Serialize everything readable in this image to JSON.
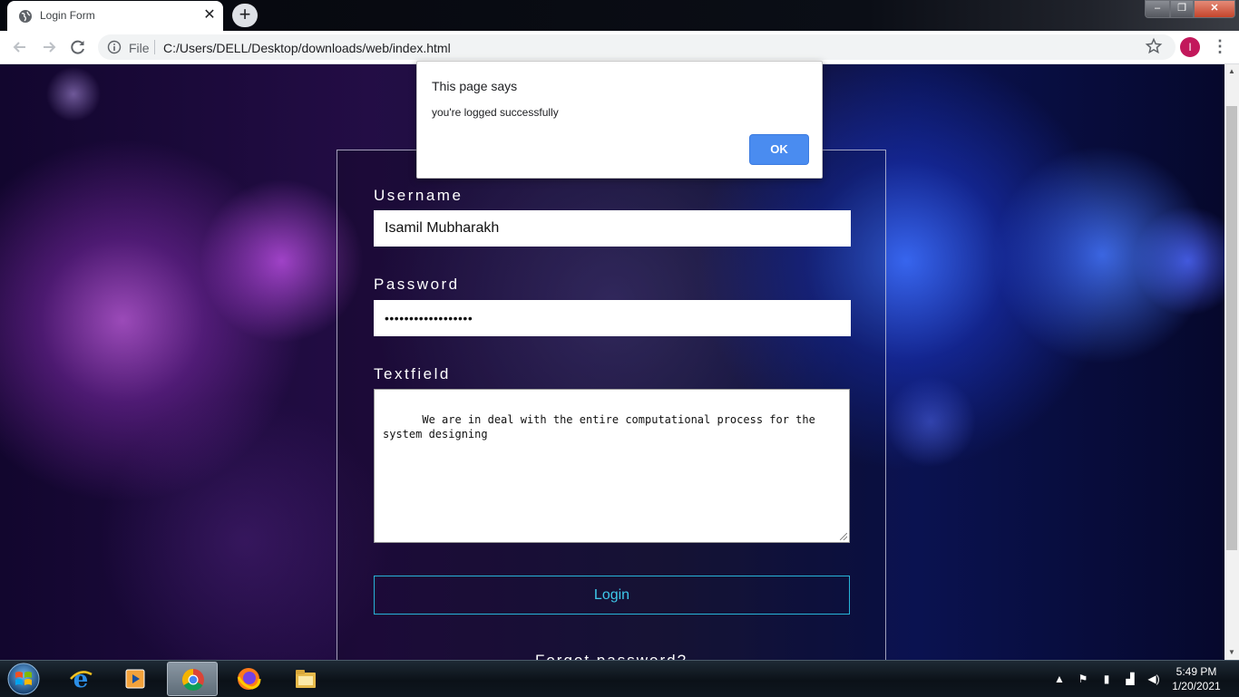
{
  "browser": {
    "tab_title": "Login Form",
    "tab_close": "✕",
    "new_tab": "+",
    "address_scheme": "File",
    "url": "C:/Users/DELL/Desktop/downloads/web/index.html",
    "profile_initial": "I",
    "window_controls": {
      "minimize": "–",
      "maximize": "❐",
      "close": "✕"
    }
  },
  "form": {
    "username_label": "Username",
    "username_value": "Isamil Mubharakh",
    "password_label": "Password",
    "password_value": "••••••••••••••••••",
    "textfield_label": "Textfield",
    "textfield_value": "We are in deal with the entire computational process for the system designing",
    "login_button": "Login",
    "forgot_link": "Forgot password?"
  },
  "alert": {
    "title": "This page says",
    "message": "you're logged successfully",
    "ok_button": "OK"
  },
  "taskbar": {
    "apps": [
      "internet-explorer",
      "media-player",
      "chrome",
      "firefox",
      "file-explorer"
    ],
    "active_app": "chrome",
    "time": "5:49 PM",
    "date": "1/20/2021"
  },
  "colors": {
    "accent_button": "#4a8cf0",
    "login_border": "#27b4d8",
    "profile": "#c2185b"
  }
}
